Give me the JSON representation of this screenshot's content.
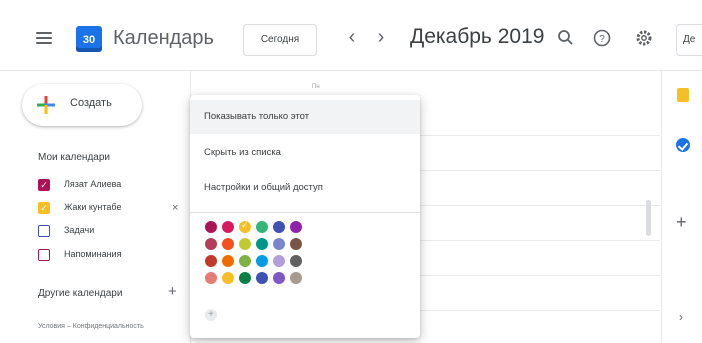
{
  "header": {
    "logo_text": "30",
    "app_title": "Календарь",
    "today_button": "Сегодня",
    "prev": "‹",
    "next": "›",
    "period": "Декабрь 2019",
    "view_button": "Де",
    "icons": [
      "menu-icon",
      "search-icon",
      "help-icon",
      "settings-icon"
    ]
  },
  "sidebar": {
    "create_label": "Создать",
    "my_calendars_title": "Мои календари",
    "my_calendars": [
      {
        "label": "Лязат Алиева",
        "color": "#ad1457",
        "checked": true
      },
      {
        "label": "Жаки кунтабе",
        "color": "#f6bf26",
        "checked": true
      },
      {
        "label": "Задачи",
        "color": "#3f51b5",
        "checked": false
      },
      {
        "label": "Напоминания",
        "color": "#ad1457",
        "checked": false
      }
    ],
    "other_calendars_title": "Другие календари",
    "add_symbol": "+",
    "remove_symbol": "×",
    "footer": "Условия – Конфиденциальность"
  },
  "grid": {
    "column_header_tiny": "Пн"
  },
  "context_menu": {
    "items": [
      "Показывать только этот",
      "Скрыть из списка",
      "Настройки и общий доступ"
    ],
    "add_color_symbol": "+",
    "palette": [
      [
        "#ad1457",
        "#d81b60",
        "#f6bf26",
        "#33b679",
        "#3f51b5",
        "#8e24aa"
      ],
      [
        "#b33e5b",
        "#f4511e",
        "#c0ca33",
        "#009688",
        "#7986cb",
        "#795548"
      ],
      [
        "#c0392b",
        "#ef6c00",
        "#7cb342",
        "#039be5",
        "#b39ddb",
        "#616161"
      ],
      [
        "#e67c73",
        "#f6bf26",
        "#0b8043",
        "#3f51b5",
        "#7e57c2",
        "#a79b8e"
      ]
    ],
    "selected_color": "#f6bf26"
  },
  "right_panel": {
    "icons": [
      "keep-icon",
      "tasks-icon",
      "add-addon-icon"
    ],
    "add_symbol": "+",
    "more_symbol": "›"
  }
}
